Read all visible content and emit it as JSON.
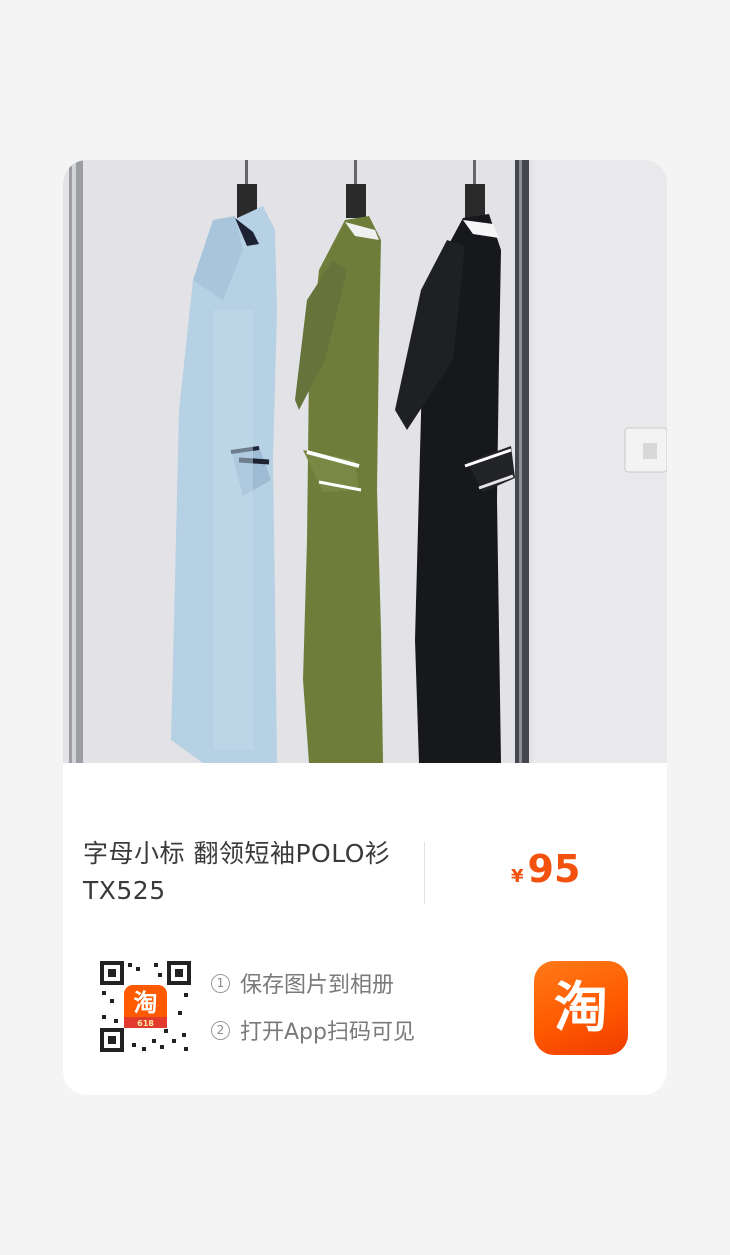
{
  "product": {
    "title_line1": "字母小标 翻领短袖POLO衫",
    "title_line2": "TX525",
    "currency": "¥",
    "price": "95"
  },
  "qr": {
    "badge_text": "淘",
    "badge_sub": "618"
  },
  "steps": [
    {
      "index": "1",
      "label": "保存图片到相册"
    },
    {
      "index": "2",
      "label": "打开App扫码可见"
    }
  ],
  "app_icon": {
    "glyph": "淘"
  },
  "colors": {
    "price": "#f2510e",
    "taobao_orange": "#ff5a00",
    "page_bg": "#f4f4f4",
    "card_bg": "#ffffff",
    "shirt_light_blue": "#b6d0e4",
    "shirt_olive": "#6f7d3b",
    "shirt_black": "#17181b"
  }
}
